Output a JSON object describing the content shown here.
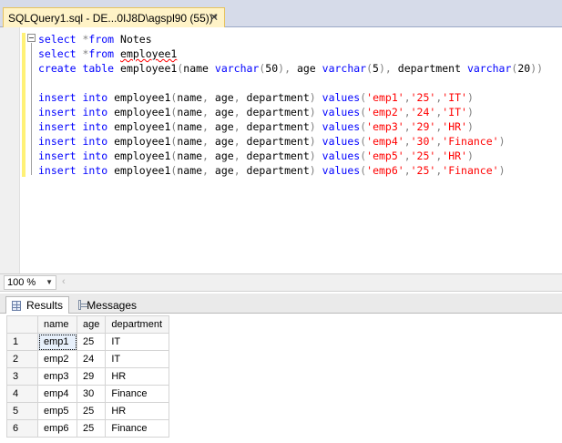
{
  "tab": {
    "title": "SQLQuery1.sql - DE...0IJ8D\\agspl90 (55))*",
    "close": "✕"
  },
  "editor": {
    "lines": [
      [
        {
          "t": "select ",
          "c": "kw"
        },
        {
          "t": "*",
          "c": "op"
        },
        {
          "t": "from ",
          "c": "kw"
        },
        {
          "t": "Notes",
          "c": ""
        }
      ],
      [
        {
          "t": "select ",
          "c": "kw"
        },
        {
          "t": "*",
          "c": "op"
        },
        {
          "t": "from ",
          "c": "kw"
        },
        {
          "t": "employee1",
          "c": "squig"
        }
      ],
      [
        {
          "t": "create table ",
          "c": "kw"
        },
        {
          "t": "employee1",
          "c": ""
        },
        {
          "t": "(",
          "c": "op"
        },
        {
          "t": "name ",
          "c": ""
        },
        {
          "t": "varchar",
          "c": "kw"
        },
        {
          "t": "(",
          "c": "op"
        },
        {
          "t": "50",
          "c": ""
        },
        {
          "t": "),",
          "c": "op"
        },
        {
          "t": " age ",
          "c": ""
        },
        {
          "t": "varchar",
          "c": "kw"
        },
        {
          "t": "(",
          "c": "op"
        },
        {
          "t": "5",
          "c": ""
        },
        {
          "t": "),",
          "c": "op"
        },
        {
          "t": " department ",
          "c": ""
        },
        {
          "t": "varchar",
          "c": "kw"
        },
        {
          "t": "(",
          "c": "op"
        },
        {
          "t": "20",
          "c": ""
        },
        {
          "t": "))",
          "c": "op"
        }
      ],
      [],
      [
        {
          "t": "insert into ",
          "c": "kw"
        },
        {
          "t": "employee1",
          "c": ""
        },
        {
          "t": "(",
          "c": "op"
        },
        {
          "t": "name",
          "c": ""
        },
        {
          "t": ",",
          "c": "op"
        },
        {
          "t": " age",
          "c": ""
        },
        {
          "t": ",",
          "c": "op"
        },
        {
          "t": " department",
          "c": ""
        },
        {
          "t": ") ",
          "c": "op"
        },
        {
          "t": "values",
          "c": "kw"
        },
        {
          "t": "(",
          "c": "op"
        },
        {
          "t": "'emp1'",
          "c": "str"
        },
        {
          "t": ",",
          "c": "op"
        },
        {
          "t": "'25'",
          "c": "str"
        },
        {
          "t": ",",
          "c": "op"
        },
        {
          "t": "'IT'",
          "c": "str"
        },
        {
          "t": ")",
          "c": "op"
        }
      ],
      [
        {
          "t": "insert into ",
          "c": "kw"
        },
        {
          "t": "employee1",
          "c": ""
        },
        {
          "t": "(",
          "c": "op"
        },
        {
          "t": "name",
          "c": ""
        },
        {
          "t": ",",
          "c": "op"
        },
        {
          "t": " age",
          "c": ""
        },
        {
          "t": ",",
          "c": "op"
        },
        {
          "t": " department",
          "c": ""
        },
        {
          "t": ") ",
          "c": "op"
        },
        {
          "t": "values",
          "c": "kw"
        },
        {
          "t": "(",
          "c": "op"
        },
        {
          "t": "'emp2'",
          "c": "str"
        },
        {
          "t": ",",
          "c": "op"
        },
        {
          "t": "'24'",
          "c": "str"
        },
        {
          "t": ",",
          "c": "op"
        },
        {
          "t": "'IT'",
          "c": "str"
        },
        {
          "t": ")",
          "c": "op"
        }
      ],
      [
        {
          "t": "insert into ",
          "c": "kw"
        },
        {
          "t": "employee1",
          "c": ""
        },
        {
          "t": "(",
          "c": "op"
        },
        {
          "t": "name",
          "c": ""
        },
        {
          "t": ",",
          "c": "op"
        },
        {
          "t": " age",
          "c": ""
        },
        {
          "t": ",",
          "c": "op"
        },
        {
          "t": " department",
          "c": ""
        },
        {
          "t": ") ",
          "c": "op"
        },
        {
          "t": "values",
          "c": "kw"
        },
        {
          "t": "(",
          "c": "op"
        },
        {
          "t": "'emp3'",
          "c": "str"
        },
        {
          "t": ",",
          "c": "op"
        },
        {
          "t": "'29'",
          "c": "str"
        },
        {
          "t": ",",
          "c": "op"
        },
        {
          "t": "'HR'",
          "c": "str"
        },
        {
          "t": ")",
          "c": "op"
        }
      ],
      [
        {
          "t": "insert into ",
          "c": "kw"
        },
        {
          "t": "employee1",
          "c": ""
        },
        {
          "t": "(",
          "c": "op"
        },
        {
          "t": "name",
          "c": ""
        },
        {
          "t": ",",
          "c": "op"
        },
        {
          "t": " age",
          "c": ""
        },
        {
          "t": ",",
          "c": "op"
        },
        {
          "t": " department",
          "c": ""
        },
        {
          "t": ") ",
          "c": "op"
        },
        {
          "t": "values",
          "c": "kw"
        },
        {
          "t": "(",
          "c": "op"
        },
        {
          "t": "'emp4'",
          "c": "str"
        },
        {
          "t": ",",
          "c": "op"
        },
        {
          "t": "'30'",
          "c": "str"
        },
        {
          "t": ",",
          "c": "op"
        },
        {
          "t": "'Finance'",
          "c": "str"
        },
        {
          "t": ")",
          "c": "op"
        }
      ],
      [
        {
          "t": "insert into ",
          "c": "kw"
        },
        {
          "t": "employee1",
          "c": ""
        },
        {
          "t": "(",
          "c": "op"
        },
        {
          "t": "name",
          "c": ""
        },
        {
          "t": ",",
          "c": "op"
        },
        {
          "t": " age",
          "c": ""
        },
        {
          "t": ",",
          "c": "op"
        },
        {
          "t": " department",
          "c": ""
        },
        {
          "t": ") ",
          "c": "op"
        },
        {
          "t": "values",
          "c": "kw"
        },
        {
          "t": "(",
          "c": "op"
        },
        {
          "t": "'emp5'",
          "c": "str"
        },
        {
          "t": ",",
          "c": "op"
        },
        {
          "t": "'25'",
          "c": "str"
        },
        {
          "t": ",",
          "c": "op"
        },
        {
          "t": "'HR'",
          "c": "str"
        },
        {
          "t": ")",
          "c": "op"
        }
      ],
      [
        {
          "t": "insert into ",
          "c": "kw"
        },
        {
          "t": "employee1",
          "c": ""
        },
        {
          "t": "(",
          "c": "op"
        },
        {
          "t": "name",
          "c": ""
        },
        {
          "t": ",",
          "c": "op"
        },
        {
          "t": " age",
          "c": ""
        },
        {
          "t": ",",
          "c": "op"
        },
        {
          "t": " department",
          "c": ""
        },
        {
          "t": ") ",
          "c": "op"
        },
        {
          "t": "values",
          "c": "kw"
        },
        {
          "t": "(",
          "c": "op"
        },
        {
          "t": "'emp6'",
          "c": "str"
        },
        {
          "t": ",",
          "c": "op"
        },
        {
          "t": "'25'",
          "c": "str"
        },
        {
          "t": ",",
          "c": "op"
        },
        {
          "t": "'Finance'",
          "c": "str"
        },
        {
          "t": ")",
          "c": "op"
        }
      ]
    ],
    "colors": {
      "keyword": "#0000ff",
      "operator": "#808080",
      "string": "#ff0000"
    }
  },
  "zoom": {
    "value": "100 %",
    "icon": "dropdown-arrow-icon"
  },
  "results": {
    "tabs": [
      {
        "label": "Results",
        "icon": "grid-icon"
      },
      {
        "label": "Messages",
        "icon": "messages-icon"
      }
    ],
    "columns": [
      "name",
      "age",
      "department"
    ],
    "rows": [
      {
        "n": "1",
        "cells": [
          "emp1",
          "25",
          "IT"
        ]
      },
      {
        "n": "2",
        "cells": [
          "emp2",
          "24",
          "IT"
        ]
      },
      {
        "n": "3",
        "cells": [
          "emp3",
          "29",
          "HR"
        ]
      },
      {
        "n": "4",
        "cells": [
          "emp4",
          "30",
          "Finance"
        ]
      },
      {
        "n": "5",
        "cells": [
          "emp5",
          "25",
          "HR"
        ]
      },
      {
        "n": "6",
        "cells": [
          "emp6",
          "25",
          "Finance"
        ]
      }
    ]
  }
}
